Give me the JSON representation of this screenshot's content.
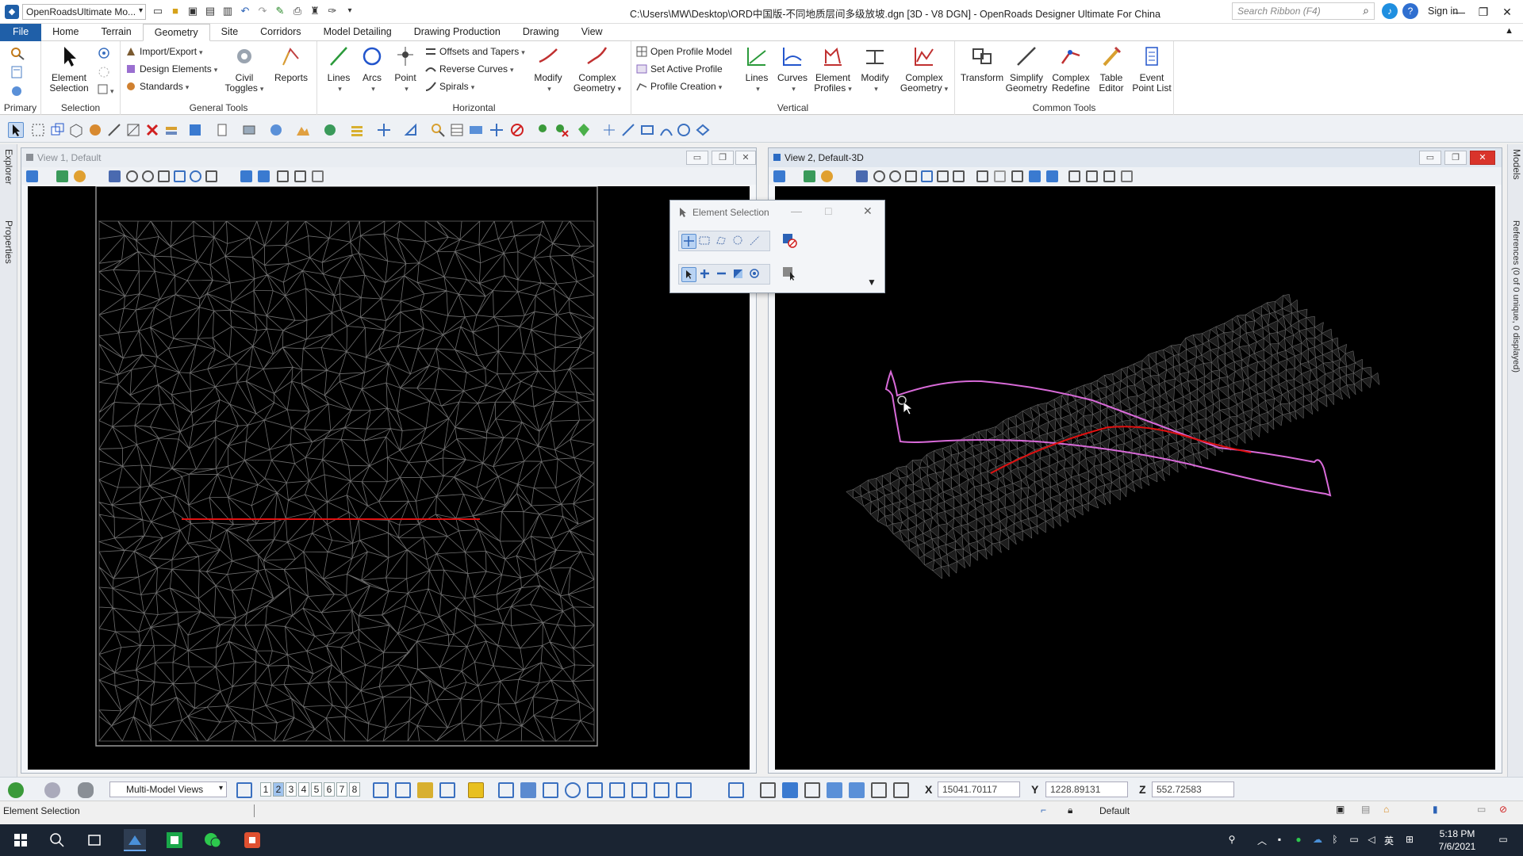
{
  "titlebar": {
    "workspace": "OpenRoadsUltimate Mo...",
    "document_title": "C:\\Users\\MW\\Desktop\\ORD中国版-不同地质层间多级放坡.dgn [3D - V8 DGN] - OpenRoads Designer Ultimate For China",
    "search_placeholder": "Search Ribbon (F4)",
    "sign_in": "Sign in"
  },
  "tabs": [
    "File",
    "Home",
    "Terrain",
    "Geometry",
    "Site",
    "Corridors",
    "Model Detailing",
    "Drawing Production",
    "Drawing",
    "View"
  ],
  "active_tab": "Geometry",
  "ribbon": {
    "primary": {
      "label": "Primary"
    },
    "selection": {
      "label": "Selection",
      "element_selection": "Element Selection"
    },
    "general_tools": {
      "label": "General Tools",
      "import_export": "Import/Export",
      "design_elements": "Design Elements",
      "standards": "Standards",
      "civil_toggles": "Civil Toggles",
      "reports": "Reports"
    },
    "horizontal": {
      "label": "Horizontal",
      "lines": "Lines",
      "arcs": "Arcs",
      "point": "Point",
      "offsets_and_tapers": "Offsets and Tapers",
      "reverse_curves": "Reverse Curves",
      "spirals": "Spirals",
      "modify": "Modify",
      "complex_geometry": "Complex Geometry"
    },
    "vertical": {
      "label": "Vertical",
      "open_profile_model": "Open Profile Model",
      "set_active_profile": "Set Active Profile",
      "profile_creation": "Profile Creation",
      "lines": "Lines",
      "curves": "Curves",
      "element_profiles": "Element Profiles",
      "modify": "Modify",
      "complex_geometry": "Complex Geometry"
    },
    "common_tools": {
      "label": "Common Tools",
      "transform": "Transform",
      "simplify_geometry": "Simplify Geometry",
      "complex_redefine": "Complex Redefine",
      "table_editor": "Table Editor",
      "event_point_list": "Event Point List"
    }
  },
  "side": {
    "explorer": "Explorer",
    "properties": "Properties",
    "models": "Models",
    "references": "References (0 of 0 unique, 0 displayed)"
  },
  "view1": {
    "title": "View 1, Default"
  },
  "view2": {
    "title": "View 2, Default-3D"
  },
  "element_selection": {
    "title": "Element Selection"
  },
  "bottom": {
    "multi_model_views": "Multi-Model Views",
    "view_numbers": [
      "1",
      "2",
      "3",
      "4",
      "5",
      "6",
      "7",
      "8"
    ],
    "x_label": "X",
    "x_value": "15041.70117",
    "y_label": "Y",
    "y_value": "1228.89131",
    "z_label": "Z",
    "z_value": "552.72583"
  },
  "status": {
    "prompt": "Element Selection",
    "level": "Default"
  },
  "taskbar": {
    "time": "5:18 PM",
    "date": "7/6/2021",
    "ime": "英"
  },
  "colors": {
    "accent": "#1f5fa8",
    "alignment_red": "#e01010",
    "boundary_magenta": "#d86ad8",
    "mesh_gray": "#7a7a7a"
  }
}
